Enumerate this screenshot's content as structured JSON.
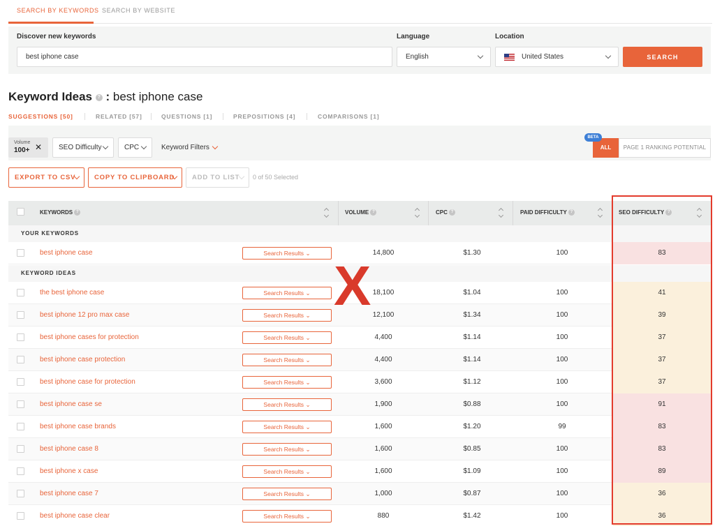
{
  "top_tabs": [
    {
      "label": "SEARCH BY KEYWORDS",
      "active": true
    },
    {
      "label": "SEARCH BY WEBSITE",
      "active": false
    }
  ],
  "search": {
    "keyword_label": "Discover new keywords",
    "keyword_value": "best iphone case",
    "language_label": "Language",
    "language_value": "English",
    "location_label": "Location",
    "location_value": "United States",
    "location_flag": "us-flag-icon",
    "button_label": "SEARCH"
  },
  "heading": {
    "title": "Keyword Ideas",
    "separator": ":",
    "query": "best iphone case"
  },
  "sub_tabs": [
    {
      "label": "SUGGESTIONS [50]",
      "active": true
    },
    {
      "label": "RELATED [57]",
      "active": false
    },
    {
      "label": "QUESTIONS [1]",
      "active": false
    },
    {
      "label": "PREPOSITIONS [4]",
      "active": false
    },
    {
      "label": "COMPARISONS [1]",
      "active": false
    }
  ],
  "filters": {
    "volume_label": "Volume",
    "volume_value": "100+",
    "seo_difficulty": "SEO Difficulty",
    "cpc": "CPC",
    "keyword_filters": "Keyword Filters",
    "beta": "BETA",
    "all": "ALL",
    "ranking_potential": "PAGE 1 RANKING POTENTIAL"
  },
  "actions": {
    "export": "EXPORT TO CSV",
    "copy": "COPY TO CLIPBOARD",
    "add": "ADD TO LIST",
    "selected": "0 of 50 Selected"
  },
  "table": {
    "columns": {
      "keywords": "KEYWORDS",
      "volume": "VOLUME",
      "cpc": "CPC",
      "paid_difficulty": "PAID DIFFICULTY",
      "seo_difficulty": "SEO DIFFICULTY"
    },
    "search_results_label": "Search Results",
    "group_your": "YOUR KEYWORDS",
    "group_ideas": "KEYWORD IDEAS",
    "your_keywords": [
      {
        "keyword": "best iphone case",
        "volume": "14,800",
        "cpc": "$1.30",
        "pd": "100",
        "sd": "83"
      }
    ],
    "keyword_ideas": [
      {
        "keyword": "the best iphone case",
        "volume": "18,100",
        "cpc": "$1.04",
        "pd": "100",
        "sd": "41"
      },
      {
        "keyword": "best iphone 12 pro max case",
        "volume": "12,100",
        "cpc": "$1.34",
        "pd": "100",
        "sd": "39"
      },
      {
        "keyword": "best iphone cases for protection",
        "volume": "4,400",
        "cpc": "$1.14",
        "pd": "100",
        "sd": "37"
      },
      {
        "keyword": "best iphone case protection",
        "volume": "4,400",
        "cpc": "$1.14",
        "pd": "100",
        "sd": "37"
      },
      {
        "keyword": "best iphone case for protection",
        "volume": "3,600",
        "cpc": "$1.12",
        "pd": "100",
        "sd": "37"
      },
      {
        "keyword": "best iphone case se",
        "volume": "1,900",
        "cpc": "$0.88",
        "pd": "100",
        "sd": "91"
      },
      {
        "keyword": "best iphone case brands",
        "volume": "1,600",
        "cpc": "$1.20",
        "pd": "99",
        "sd": "83"
      },
      {
        "keyword": "best iphone case 8",
        "volume": "1,600",
        "cpc": "$0.85",
        "pd": "100",
        "sd": "83"
      },
      {
        "keyword": "best iphone x case",
        "volume": "1,600",
        "cpc": "$1.09",
        "pd": "100",
        "sd": "89"
      },
      {
        "keyword": "best iphone case 7",
        "volume": "1,000",
        "cpc": "$0.87",
        "pd": "100",
        "sd": "36"
      },
      {
        "keyword": "best iphone case clear",
        "volume": "880",
        "cpc": "$1.42",
        "pd": "100",
        "sd": "36"
      }
    ]
  },
  "annotation": {
    "mark": "X"
  },
  "colors": {
    "accent": "#e8643a",
    "difficulty_easy": "#fbf0dc",
    "difficulty_hard": "#f9e1e1",
    "annotation_red": "#e33b2c"
  }
}
